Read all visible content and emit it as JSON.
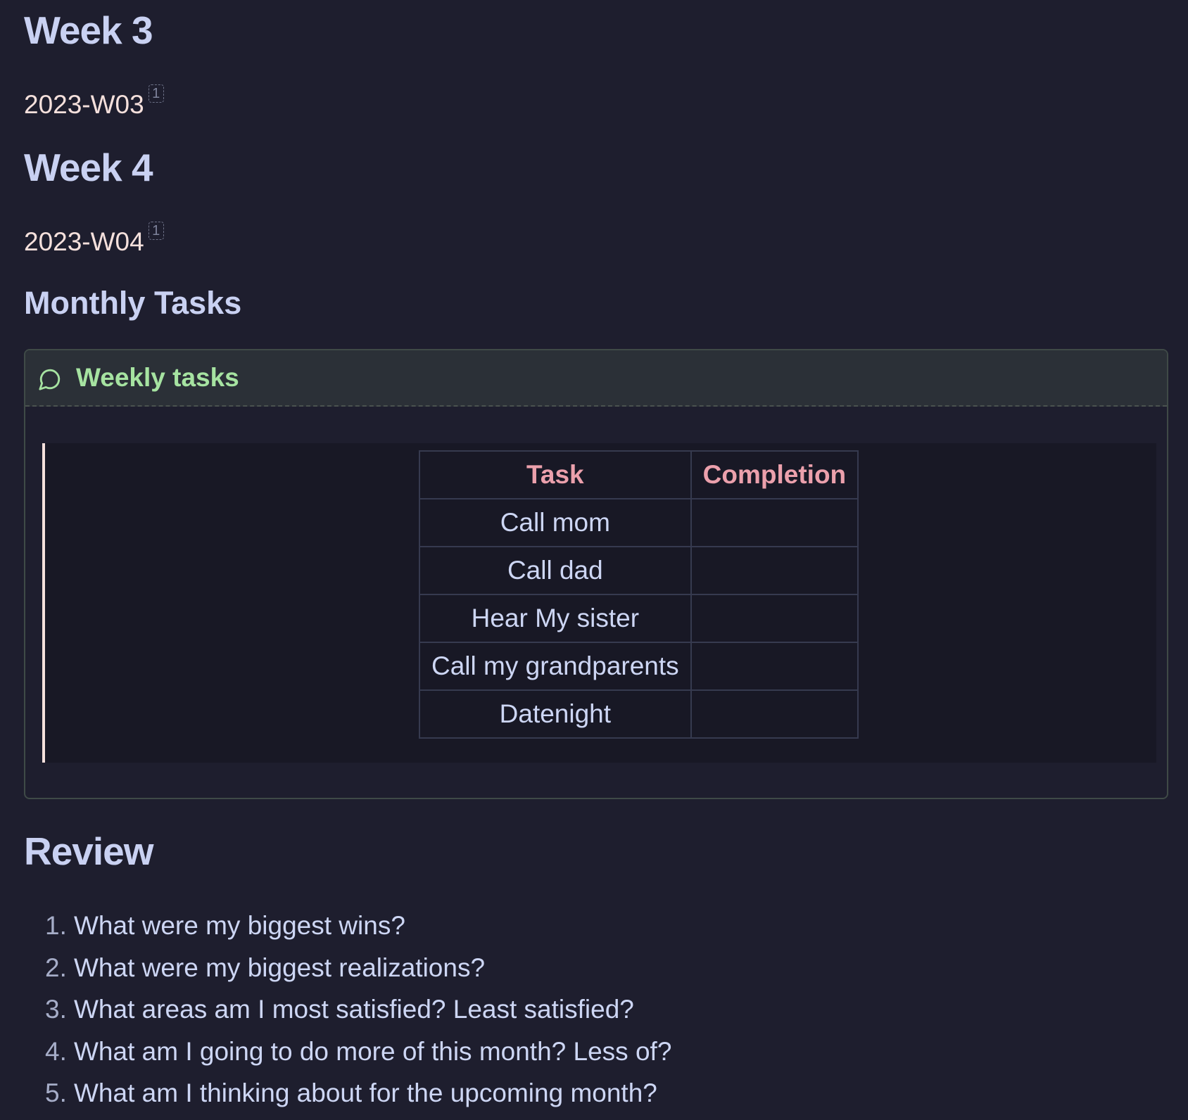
{
  "sections": {
    "week3": {
      "heading": "Week 3",
      "link": "2023-W03",
      "footnote": "1"
    },
    "week4": {
      "heading": "Week 4",
      "link": "2023-W04",
      "footnote": "1"
    },
    "monthly_tasks": {
      "heading": "Monthly Tasks"
    },
    "review": {
      "heading": "Review"
    }
  },
  "callout": {
    "icon": "speech-bubble-icon",
    "title": "Weekly tasks",
    "title_color": "#a6e3a1"
  },
  "tasks_table": {
    "headers": [
      "Task",
      "Completion"
    ],
    "rows": [
      [
        "Call mom",
        ""
      ],
      [
        "Call dad",
        ""
      ],
      [
        "Hear My sister",
        ""
      ],
      [
        "Call my grandparents",
        ""
      ],
      [
        "Datenight",
        ""
      ]
    ]
  },
  "review_questions": [
    {
      "num": "1.",
      "text": "What were my biggest wins?"
    },
    {
      "num": "2.",
      "text": "What were my biggest realizations?"
    },
    {
      "num": "3.",
      "text": "What areas am I most satisfied? Least satisfied?"
    },
    {
      "num": "4.",
      "text": "What am I going to do more of this month? Less of?"
    },
    {
      "num": "5.",
      "text": "What am I thinking about for the upcoming month?"
    }
  ],
  "colors": {
    "background": "#1e1e2e",
    "heading": "#c9d1f2",
    "link": "#f5e0dc",
    "table_header": "#eba0ac"
  }
}
